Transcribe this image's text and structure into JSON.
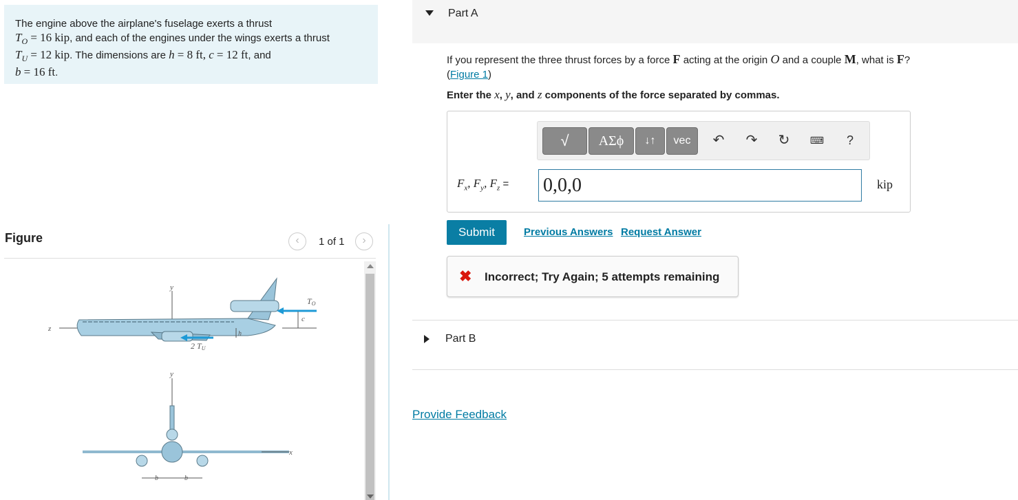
{
  "problem": {
    "intro": "The engine above the airplane's fuselage exerts a thrust",
    "T0_sym": "T",
    "T0_sub": "O",
    "T0_val": "= 16 kip",
    "line2": ", and each of the engines under the wings exerts a thrust",
    "TU_sym": "T",
    "TU_sub": "U",
    "TU_val": "= 12 kip",
    "line3": ". The dimensions are",
    "h_sym": "h",
    "h_val": "= 8 ft,",
    "c_sym": "c",
    "c_val": "= 12 ft",
    "and": ", and",
    "b_sym": "b",
    "b_val": "= 16 ft",
    "period": "."
  },
  "figure": {
    "title": "Figure",
    "pager": "1 of 1",
    "prev_icon": "chevron-left-icon",
    "next_icon": "chevron-right-icon",
    "labels": {
      "y1": "y",
      "z": "z",
      "T0": "T",
      "T0_sub": "O",
      "c": "c",
      "h": "h",
      "TU2": "2 T",
      "TU2_sub": "U",
      "y2": "y",
      "x": "x",
      "b1": "b",
      "b2": "b"
    }
  },
  "partA": {
    "title": "Part A",
    "q1": "If you represent the three thrust forces by a force",
    "F": "F",
    "q2": "acting at the origin",
    "O": "O",
    "q3": "and a couple",
    "M": "M",
    "q4": ", what is",
    "F2": "F",
    "q5": "?",
    "fig_link": "Figure 1",
    "instr1": "Enter the",
    "x": "x",
    "y": "y",
    "and": "and",
    "z": "z",
    "instr2": "components of the force separated by commas.",
    "toolbar": {
      "sqrt_label": "√",
      "greek_label": "ΑΣϕ",
      "arrows_label": "↓↑",
      "vec_label": "vec",
      "help_label": "?"
    },
    "eq_label": "F",
    "answer_value": "0,0,0",
    "unit": "kip",
    "submit": "Submit",
    "previous_answers": "Previous Answers",
    "request_answer": "Request Answer",
    "feedback": "Incorrect; Try Again; 5 attempts remaining"
  },
  "partB": {
    "title": "Part B"
  },
  "provide_feedback": "Provide Feedback",
  "colors": {
    "accent": "#0a7ea4",
    "error": "#d9160b",
    "problem_bg": "#e8f4f8"
  }
}
